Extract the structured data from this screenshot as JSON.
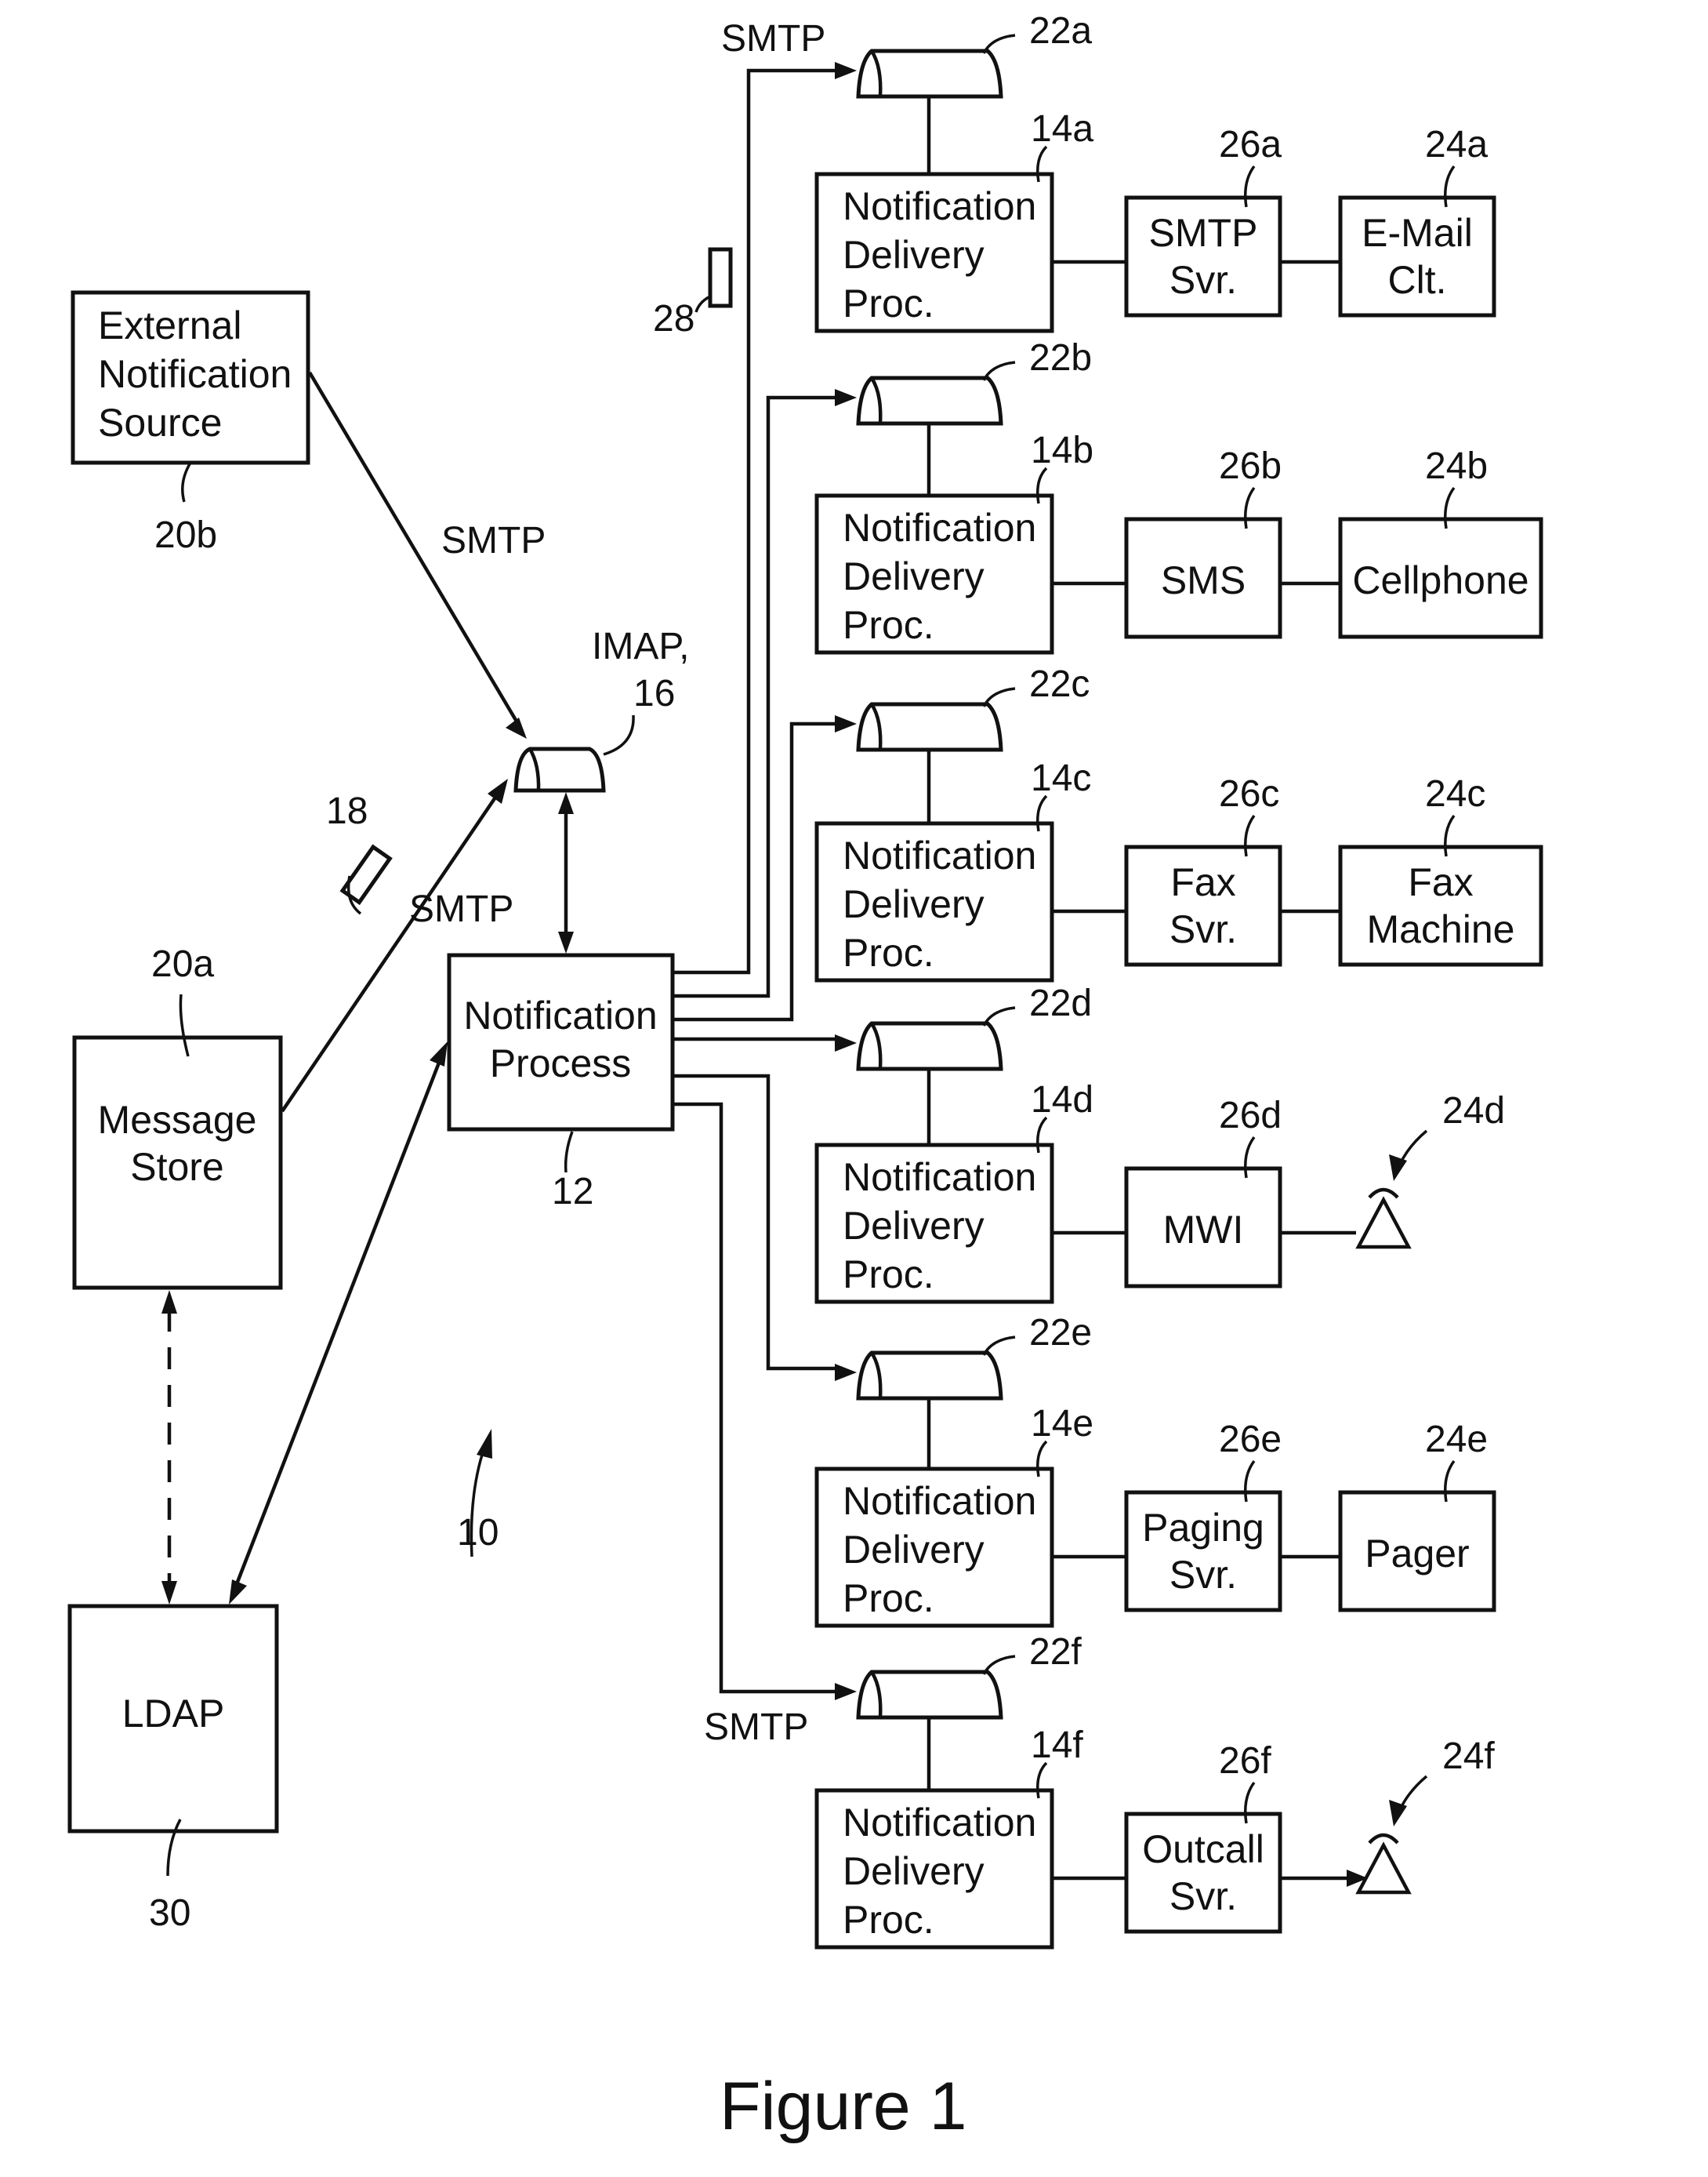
{
  "figure": {
    "title": "Figure 1",
    "system_ref": "10"
  },
  "nodes": {
    "external_source": {
      "lines": [
        "External",
        "Notification",
        "Source"
      ],
      "ref": "20b"
    },
    "message_store": {
      "lines": [
        "Message",
        "Store"
      ],
      "ref": "20a"
    },
    "ldap": {
      "lines": [
        "LDAP"
      ],
      "ref": "30"
    },
    "notification_process": {
      "lines": [
        "Notification",
        "Process"
      ],
      "ref": "12"
    },
    "imap": {
      "label": "IMAP,",
      "ref": "16"
    },
    "message_18": {
      "ref": "18"
    },
    "message_28": {
      "ref": "28"
    }
  },
  "edge_labels": {
    "ext_to_imap": "SMTP",
    "store_to_imap": "SMTP",
    "to_22a": "SMTP",
    "to_22f": "SMTP"
  },
  "branches": [
    {
      "queue": "22a",
      "proc_ref": "14a",
      "proc_lines": [
        "Notification",
        "Delivery",
        "Proc."
      ],
      "server_ref": "26a",
      "server_lines": [
        "SMTP",
        "Svr."
      ],
      "device_ref": "24a",
      "device_lines": [
        "E-Mail",
        "Clt."
      ]
    },
    {
      "queue": "22b",
      "proc_ref": "14b",
      "proc_lines": [
        "Notification",
        "Delivery",
        "Proc."
      ],
      "server_ref": "26b",
      "server_lines": [
        "SMS"
      ],
      "device_ref": "24b",
      "device_lines": [
        "Cellphone"
      ]
    },
    {
      "queue": "22c",
      "proc_ref": "14c",
      "proc_lines": [
        "Notification",
        "Delivery",
        "Proc."
      ],
      "server_ref": "26c",
      "server_lines": [
        "Fax",
        "Svr."
      ],
      "device_ref": "24c",
      "device_lines": [
        "Fax",
        "Machine"
      ]
    },
    {
      "queue": "22d",
      "proc_ref": "14d",
      "proc_lines": [
        "Notification",
        "Delivery",
        "Proc."
      ],
      "server_ref": "26d",
      "server_lines": [
        "MWI"
      ],
      "device_ref": "24d",
      "device_lines": []
    },
    {
      "queue": "22e",
      "proc_ref": "14e",
      "proc_lines": [
        "Notification",
        "Delivery",
        "Proc."
      ],
      "server_ref": "26e",
      "server_lines": [
        "Paging",
        "Svr."
      ],
      "device_ref": "24e",
      "device_lines": [
        "Pager"
      ]
    },
    {
      "queue": "22f",
      "proc_ref": "14f",
      "proc_lines": [
        "Notification",
        "Delivery",
        "Proc."
      ],
      "server_ref": "26f",
      "server_lines": [
        "Outcall",
        "Svr."
      ],
      "device_ref": "24f",
      "device_lines": []
    }
  ]
}
